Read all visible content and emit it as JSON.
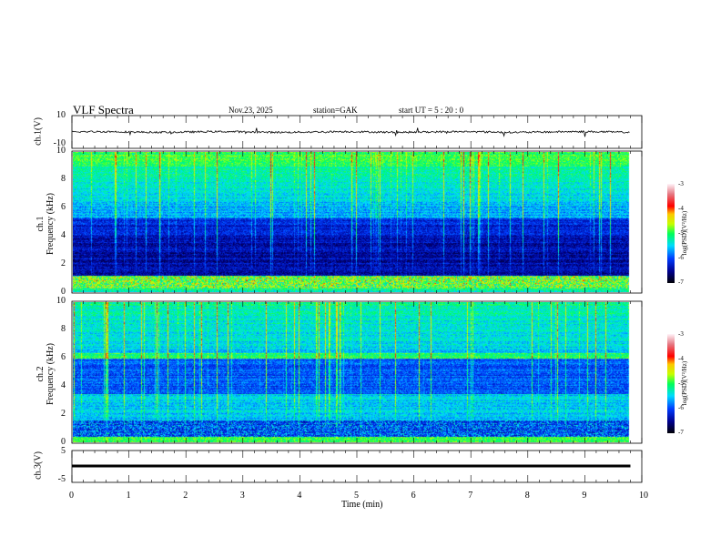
{
  "header": {
    "title": "VLF  Spectra",
    "date": "Nov.23, 2025",
    "station": "station=GAK",
    "start": "start  UT =   5  : 20 : 0"
  },
  "chart_data": [
    {
      "type": "line",
      "panel": "ch1-waveform",
      "ylabel": "ch.1(V)",
      "ylim": [
        -10,
        10
      ],
      "yticks": [
        "10",
        "-10"
      ],
      "xlim": [
        0,
        10
      ],
      "description_values": {
        "baseline": 0,
        "noise_amplitude": 1
      }
    },
    {
      "type": "heatmap",
      "panel": "ch1-spectrogram",
      "ylabel": "ch.1\nFrequency (kHz)",
      "ylabel_line1": "ch.1",
      "ylabel_line2": "Frequency  (kHz)",
      "ylim": [
        0,
        10
      ],
      "yticks": [
        "10",
        "8",
        "6",
        "4",
        "2",
        "0"
      ],
      "xlim": [
        0,
        10
      ],
      "data_end_min": 9.8,
      "colorbar": {
        "label": "log(PSD)(V²/Hz)",
        "range": [
          -7,
          -3
        ],
        "ticks": [
          "-3",
          "-4",
          "-5",
          "-6",
          "-7"
        ]
      }
    },
    {
      "type": "heatmap",
      "panel": "ch2-spectrogram",
      "ylabel_line1": "ch.2",
      "ylabel_line2": "Frequency  (kHz)",
      "ylim": [
        0,
        10
      ],
      "yticks": [
        "10",
        "8",
        "6",
        "4",
        "2",
        "0"
      ],
      "xlim": [
        0,
        10
      ],
      "data_end_min": 9.8,
      "colorbar": {
        "label": "log(PSD)(V²/Hz)",
        "range": [
          -7,
          -3
        ],
        "ticks": [
          "-3",
          "-4",
          "-5",
          "-6",
          "-7"
        ]
      }
    },
    {
      "type": "line",
      "panel": "ch3-waveform",
      "ylabel": "ch.3(V)",
      "ylim": [
        -5,
        5
      ],
      "yticks": [
        "5",
        "0",
        "-5"
      ],
      "xlim": [
        0,
        10
      ],
      "xlabel": "Time  (min)",
      "xticks": [
        "0",
        "1",
        "2",
        "3",
        "4",
        "5",
        "6",
        "7",
        "8",
        "9",
        "10"
      ],
      "description_values": {
        "level": -1.5
      }
    }
  ]
}
